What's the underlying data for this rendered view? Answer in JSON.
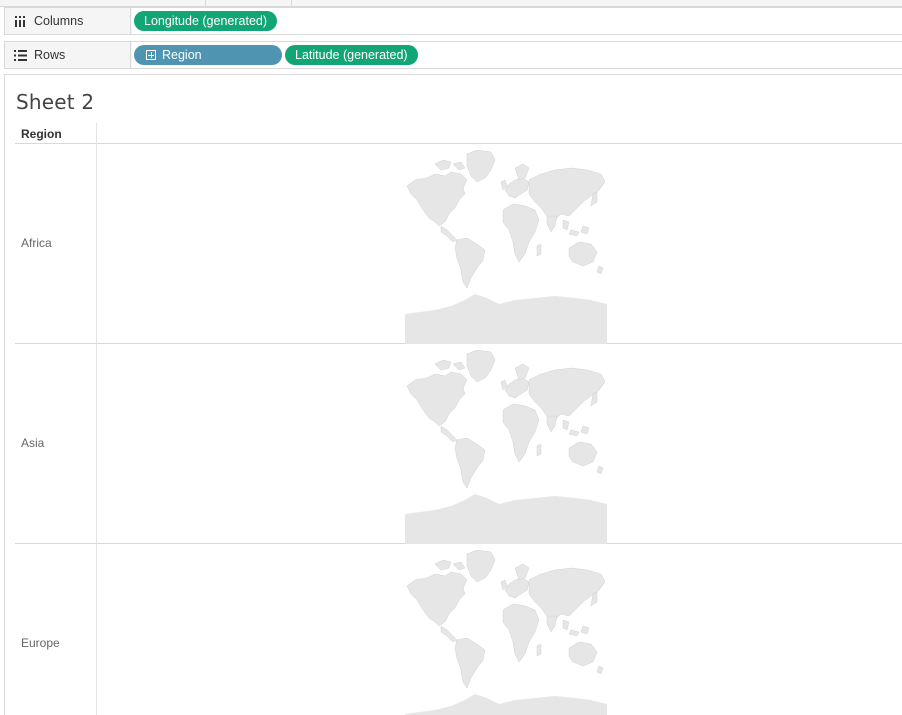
{
  "shelves": {
    "columns": {
      "label": "Columns",
      "icon": "columns-icon",
      "pills": [
        {
          "label": "Longitude (generated)",
          "color": "#12a575"
        }
      ]
    },
    "rows": {
      "label": "Rows",
      "icon": "rows-icon",
      "pills": [
        {
          "label": "Region",
          "color": "#4f95b2",
          "icon": "expand-plus-icon"
        },
        {
          "label": "Latitude (generated)",
          "color": "#12a575"
        }
      ]
    }
  },
  "sheet": {
    "title": "Sheet 2",
    "row_header": "Region",
    "rows": [
      {
        "label": "Africa",
        "map": "world-map"
      },
      {
        "label": "Asia",
        "map": "world-map"
      },
      {
        "label": "Europe",
        "map": "world-map"
      }
    ]
  },
  "colors": {
    "dimension_pill": "#4f95b2",
    "measure_pill": "#12a575",
    "map_land": "#e6e6e6"
  }
}
